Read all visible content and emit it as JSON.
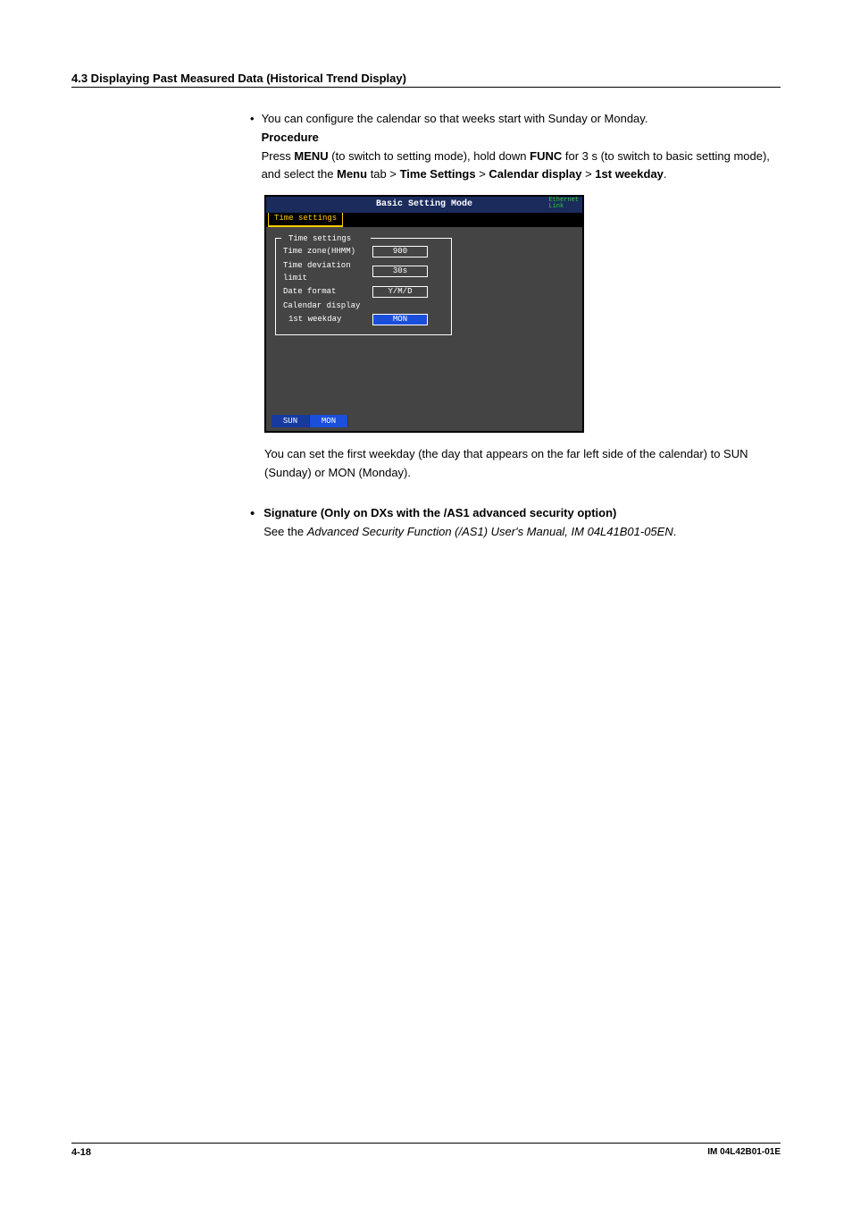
{
  "section_header": "4.3  Displaying Past Measured Data (Historical Trend Display)",
  "bullet1_text": "You can configure the calendar so that weeks start with Sunday or Monday.",
  "procedure_label": "Procedure",
  "proc": {
    "p1a": "Press ",
    "p1b": "MENU",
    "p1c": " (to switch to setting mode), hold down ",
    "p1d": "FUNC",
    "p1e": " for 3 s (to switch to basic setting mode), and select the ",
    "p1f": "Menu",
    "p1g": " tab > ",
    "p1h": "Time Settings",
    "p1i": " > ",
    "p1j": "Calendar display",
    "p1k": " > ",
    "p1l": "1st weekday",
    "p1m": "."
  },
  "ss": {
    "title": "Basic Setting Mode",
    "eth1": "Ethernet",
    "eth2": "Link",
    "tab": "Time settings",
    "legend": "Time settings",
    "rows": [
      {
        "label": "Time zone(HHMM)",
        "value": "900"
      },
      {
        "label": "Time deviation limit",
        "value": "30s"
      },
      {
        "label": "Date format",
        "value": "Y/M/D"
      }
    ],
    "row_noval": "Calendar display",
    "row_sel": {
      "label": "1st weekday",
      "value": "MON"
    },
    "opts": [
      "SUN",
      "MON"
    ]
  },
  "after": "You can set the first weekday (the day that appears on the far left side of the calendar) to SUN (Sunday) or MON (Monday).",
  "sig": {
    "title": "Signature (Only on DXs with the /AS1 advanced security option)",
    "a": "See the ",
    "b": "Advanced Security Function (/AS1) User's Manual, IM 04L41B01-05EN",
    "c": "."
  },
  "footer": {
    "page": "4-18",
    "doc": "IM 04L42B01-01E"
  }
}
